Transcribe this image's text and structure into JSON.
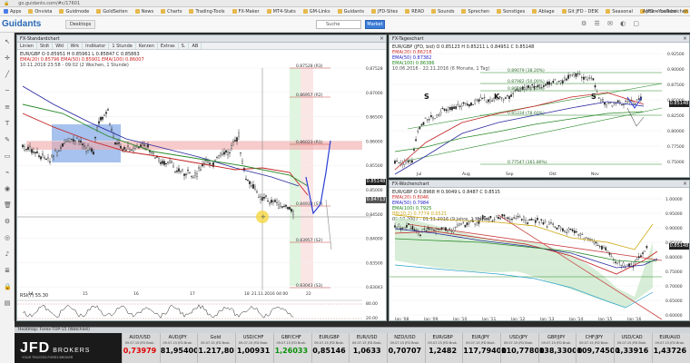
{
  "browser": {
    "apps_label": "Apps",
    "url": "go.guidants.com/#c/17601",
    "bookmarks": [
      "Onvista",
      "Guidmode",
      "GoldSeiten",
      "News",
      "Charts",
      "Trading-Tools",
      "FX-Maker",
      "MT4-Stats",
      "GM-Links",
      "Guidants",
      "JFD-Sites",
      "READ",
      "Sounds",
      "Sprechen",
      "Sonstiges",
      "Ablage",
      "Git JFD - DEIK",
      "Seasonal",
      "JFD - YouTube",
      "Live - YouTube",
      "3. Quartal 2016"
    ],
    "right": [
      "Andere Lesezeichen"
    ]
  },
  "app_header": {
    "logo": "Guidants",
    "buttons": [
      "Desktops"
    ],
    "search_placeholder": "Suche",
    "blue_button": "Market"
  },
  "left_toolbar_icons": [
    "cursor-icon",
    "crosshair-icon",
    "trendline-icon",
    "hline-icon",
    "fib-icon",
    "text-icon",
    "brush-icon",
    "shape-icon",
    "magnet-icon",
    "eye-icon",
    "trash-icon",
    "settings-icon",
    "camera-icon",
    "bell-icon",
    "layers-icon",
    "lock-icon",
    "folder-icon"
  ],
  "pane_main": {
    "title": "FX-Standardchart",
    "tools": [
      "Linien",
      "Stdt",
      "Wkl",
      "Wrk",
      "Indikator",
      "1 Stunde",
      "Kerzen",
      "Extras",
      "S.",
      "AB"
    ],
    "legend": [
      {
        "text": "EUR/GBP  O 0.85951  H 0.85961  L 0.85847  C 0.85863",
        "color": "#222222"
      },
      {
        "text": "EMA(20) 0.85796   EMA(50) 0.85901   EMA(100) 0.86007",
        "color": "#cc2222"
      },
      {
        "text": "10.11.2016 23:58 - 09:02  (2 Wochen, 1 Stunde)",
        "color": "#444444"
      }
    ],
    "price_labels": [
      "0.87528",
      "0.87000",
      "0.86500",
      "0.86000",
      "0.85500",
      "0.85000",
      "0.84500",
      "0.84000",
      "0.83500",
      "0.83043"
    ],
    "fib_labels": [
      "0.87528 (R3)",
      "0.86957 (R2)",
      "0.86023 (R1)",
      "0.84938 (S1)",
      "0.83957 (S2)",
      "0.83043 (S3)"
    ],
    "tags": [
      {
        "text": "0.85148",
        "color": "#222222"
      },
      {
        "text": "0.84713",
        "color": "#555555"
      }
    ],
    "date_labels": [
      "14",
      "15",
      "16",
      "17",
      "18",
      "21.11.2016 04:00",
      "22"
    ],
    "rsi_label": "RSI(7)  55.30",
    "rsi_levels": [
      "80.00",
      "20.00"
    ],
    "rsi_value": "55.30"
  },
  "pane_daily": {
    "title": "FX-Tageschart",
    "legend": [
      {
        "text": "EUR/GBP (JFD, bid)  O 0.85123  H 0.85211  L 0.84951  C 0.85148",
        "color": "#222222"
      },
      {
        "text": "EMA(20)  0.86218",
        "color": "#cc2222"
      },
      {
        "text": "EMA(50)  0.87382",
        "color": "#2222cc"
      },
      {
        "text": "EMA(100) 0.86386",
        "color": "#228822"
      },
      {
        "text": "10.06.2016 - 22.11.2016  (6 Monate, 1 Tag)",
        "color": "#444444"
      }
    ],
    "fib_labels": [
      "0.89079 (38.20%)",
      "0.87982 (50.00%)",
      "0.86880 (61.80%)",
      "0.85334 (78.60%)",
      "0.77547 (161.80%)"
    ],
    "price_labels": [
      "0.92500",
      "0.90000",
      "0.87500",
      "0.85000",
      "0.82500",
      "0.80000",
      "0.77500",
      "0.75000"
    ],
    "date_labels": [
      "Jul",
      "Aug",
      "Sep",
      "Okt",
      "Nov"
    ],
    "pattern_labels": [
      "S",
      "K",
      "S"
    ],
    "tag": "0.85148"
  },
  "pane_weekly": {
    "title": "FX-Wochenchart",
    "legend": [
      {
        "text": "EUR/GBP  O 0.8968  H 0.9049  L 0.8487  C 0.8515",
        "color": "#222222"
      },
      {
        "text": "EMA(20)  0.8046",
        "color": "#cc2222"
      },
      {
        "text": "EMA(50)  0.7984",
        "color": "#2222cc"
      },
      {
        "text": "EMA(100) 0.7925",
        "color": "#228822"
      },
      {
        "text": "BB(20,2)  0.7774  0.6521",
        "color": "#c9a100"
      },
      {
        "text": "01.10.2007 - 01.11.2016  (9 Jahre, 1 Monat)",
        "color": "#444444"
      }
    ],
    "price_labels": [
      "1.00000",
      "0.95000",
      "0.90000",
      "0.85000",
      "0.80000",
      "0.75000",
      "0.70000",
      "0.65000",
      "0.60000"
    ],
    "date_labels": [
      "Jan '08",
      "Jan '09",
      "Jan '10",
      "Jan '11",
      "Jan '12",
      "Jan '13",
      "Jan '14",
      "Jan '15",
      "Jan '16"
    ],
    "tag": "0.85148"
  },
  "heatmap": {
    "title": "Heatmap: Forex-TOP-15 (Watchlist)",
    "brand": "JFD",
    "brand_suffix": "BROKERS",
    "brand_sub": "YOUR TRUSTED FOREX BROKER",
    "items": [
      {
        "sym": "AUD/USD",
        "ts": "09.07.15 JFD Brok.",
        "px": "0,73979",
        "color": "#e00000"
      },
      {
        "sym": "AUD/JPY",
        "ts": "09.07.15 JFD Brok.",
        "px": "81,95400",
        "color": "#000000"
      },
      {
        "sym": "Gold",
        "ts": "09.07.15 JFD Brok.",
        "px": "1.217,80",
        "color": "#000000"
      },
      {
        "sym": "USD/CHF",
        "ts": "09.07.15 JFD Brok.",
        "px": "1,00931",
        "color": "#000000"
      },
      {
        "sym": "GBP/CHF",
        "ts": "09.07.15 JFD Brok.",
        "px": "1,26033",
        "color": "#0a8f0a"
      },
      {
        "sym": "EUR/GBP",
        "ts": "09.07.15 JFD Brok.",
        "px": "0,85146",
        "color": "#000000"
      },
      {
        "sym": "EUR/USD",
        "ts": "09.07.15 JFD Brok.",
        "px": "1,0633",
        "color": "#000000"
      },
      {
        "sym": "NZD/USD",
        "ts": "09.07.15 JFD Brok.",
        "px": "0,70707",
        "color": "#000000"
      },
      {
        "sym": "EUR/GBP",
        "ts": "09.07.15 JFD Brok.",
        "px": "1,2482",
        "color": "#000000"
      },
      {
        "sym": "EUR/JPY",
        "ts": "09.07.15 JFD Brok.",
        "px": "117,79400",
        "color": "#000000"
      },
      {
        "sym": "USD/JPY",
        "ts": "09.07.15 JFD Brok.",
        "px": "110,77800",
        "color": "#000000"
      },
      {
        "sym": "GBP/JPY",
        "ts": "09.07.15 JFD Brok.",
        "px": "138,33000",
        "color": "#000000"
      },
      {
        "sym": "CHF/JPY",
        "ts": "09.07.15 JFD Brok.",
        "px": "109,74500",
        "color": "#000000"
      },
      {
        "sym": "USD/CAD",
        "ts": "09.07.15 JFD Brok.",
        "px": "1,33916",
        "color": "#000000"
      },
      {
        "sym": "EUR/AUD",
        "ts": "09.07.15 JFD Brok.",
        "px": "1,43726",
        "color": "#000000"
      }
    ]
  }
}
